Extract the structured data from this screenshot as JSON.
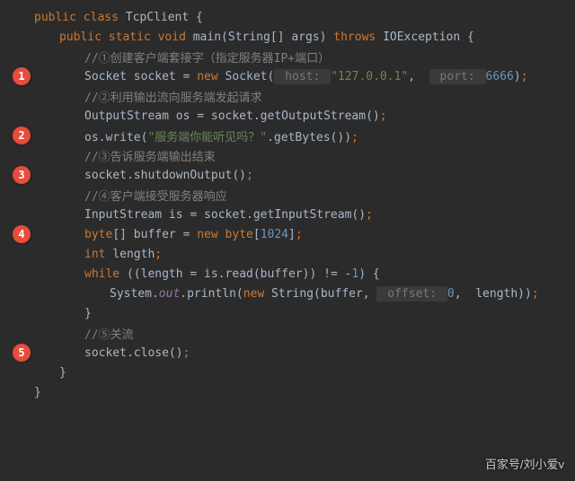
{
  "badges": {
    "b1": "1",
    "b2": "2",
    "b3": "3",
    "b4": "4",
    "b5": "5"
  },
  "code": {
    "l1_public": "public ",
    "l1_class": "class ",
    "l1_name": "TcpClient {",
    "l2_pub": "public ",
    "l2_stat": "static ",
    "l2_void": "void ",
    "l2_main": "main",
    "l2_p1": "(String[] args) ",
    "l2_throws": "throws ",
    "l2_exc": "IOException {",
    "c1": "//①创建客户端套接字（指定服务器IP+端口）",
    "l3_a": "Socket socket = ",
    "l3_new": "new ",
    "l3_b": "Socket(",
    "l3_h1": " host: ",
    "l3_s1": "\"127.0.0.1\"",
    "l3_com": ",  ",
    "l3_h2": " port: ",
    "l3_n": "6666",
    "l3_rp": ")",
    "l3_sc": ";",
    "c2": "//②利用输出流向服务端发起请求",
    "l4_a": "OutputStream os = socket.getOutputStream()",
    "l4_sc": ";",
    "l5_a": "os.write(",
    "l5_s": "\"服务端你能听见吗？\"",
    "l5_b": ".getBytes())",
    "l5_sc": ";",
    "c3": "//③告诉服务端输出结束",
    "l6_a": "socket.shutdownOutput()",
    "l6_sc": ";",
    "c4": "//④客户端接受服务器响应",
    "l7_a": "InputStream is = socket.getInputStream()",
    "l7_sc": ";",
    "l8_byte": "byte",
    "l8_a": "[] buffer = ",
    "l8_new": "new ",
    "l8_byte2": "byte",
    "l8_lb": "[",
    "l8_n": "1024",
    "l8_rb": "]",
    "l8_sc": ";",
    "l9_int": "int ",
    "l9_a": "length",
    "l9_sc": ";",
    "l10_while": "while ",
    "l10_a": "((length = is.read(buffer)) != -",
    "l10_n": "1",
    "l10_b": ") {",
    "l11_a": "System.",
    "l11_out": "out",
    "l11_b": ".println(",
    "l11_new": "new ",
    "l11_c": "String(buffer, ",
    "l11_h": " offset: ",
    "l11_n": "0",
    "l11_d": ",  length))",
    "l11_sc": ";",
    "l12": "}",
    "c5": "//⑤关流",
    "l13_a": "socket.close()",
    "l13_sc": ";",
    "l14": "}",
    "l15": "}"
  },
  "watermark": "百家号/刘小爱v"
}
